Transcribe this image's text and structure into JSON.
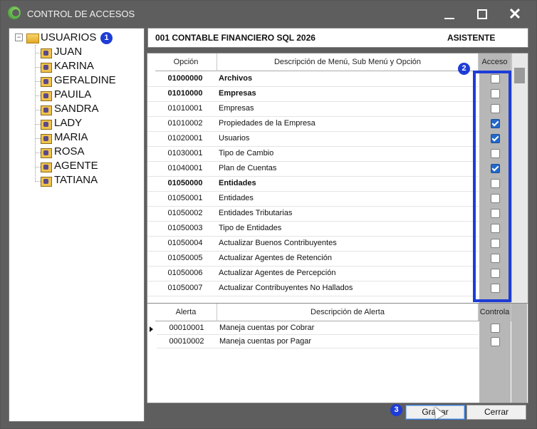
{
  "window": {
    "title": "CONTROL DE ACCESOS"
  },
  "tree": {
    "root": "USUARIOS",
    "users": [
      "JUAN",
      "KARINA",
      "GERALDINE",
      "PAUILA",
      "SANDRA",
      "LADY",
      "MARIA",
      "ROSA",
      "AGENTE",
      "TATIANA"
    ]
  },
  "badges": [
    "1",
    "2",
    "3"
  ],
  "header": {
    "company": "001 CONTABLE FINANCIERO SQL 2026",
    "role": "ASISTENTE"
  },
  "menu_grid": {
    "columns": [
      "Opción",
      "Descripción de Menú, Sub Menú y Opción",
      "Acceso"
    ],
    "rows": [
      {
        "code": "01000000",
        "desc": "Archivos",
        "bold": true,
        "access": false
      },
      {
        "code": "01010000",
        "desc": "Empresas",
        "bold": true,
        "access": false
      },
      {
        "code": "01010001",
        "desc": "Empresas",
        "bold": false,
        "access": false
      },
      {
        "code": "01010002",
        "desc": "Propiedades de la Empresa",
        "bold": false,
        "access": true
      },
      {
        "code": "01020001",
        "desc": "Usuarios",
        "bold": false,
        "access": true
      },
      {
        "code": "01030001",
        "desc": "Tipo de Cambio",
        "bold": false,
        "access": false
      },
      {
        "code": "01040001",
        "desc": "Plan de Cuentas",
        "bold": false,
        "access": true
      },
      {
        "code": "01050000",
        "desc": "Entidades",
        "bold": true,
        "access": false
      },
      {
        "code": "01050001",
        "desc": "Entidades",
        "bold": false,
        "access": false
      },
      {
        "code": "01050002",
        "desc": "Entidades Tributarias",
        "bold": false,
        "access": false
      },
      {
        "code": "01050003",
        "desc": "Tipo de Entidades",
        "bold": false,
        "access": false
      },
      {
        "code": "01050004",
        "desc": "Actualizar Buenos Contribuyentes",
        "bold": false,
        "access": false
      },
      {
        "code": "01050005",
        "desc": "Actualizar Agentes de Retención",
        "bold": false,
        "access": false
      },
      {
        "code": "01050006",
        "desc": "Actualizar Agentes de Percepción",
        "bold": false,
        "access": false
      },
      {
        "code": "01050007",
        "desc": "Actualizar Contribuyentes No Hallados",
        "bold": false,
        "access": false
      }
    ]
  },
  "alert_grid": {
    "columns": [
      "Alerta",
      "Descripción de Alerta",
      "Controla"
    ],
    "rows": [
      {
        "code": "00010001",
        "desc": "Maneja cuentas por Cobrar",
        "control": false
      },
      {
        "code": "00010002",
        "desc": "Maneja cuentas por Pagar",
        "control": false
      }
    ]
  },
  "buttons": {
    "save": "Grabar",
    "close": "Cerrar"
  },
  "colors": {
    "highlight": "#1e3cd6",
    "checked": "#2468c9",
    "title_bg": "#5e5e5e"
  }
}
